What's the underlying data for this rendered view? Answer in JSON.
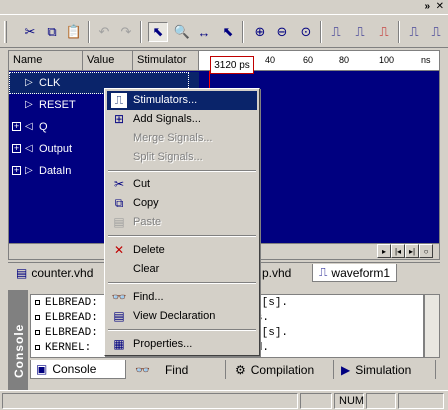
{
  "toolbar": {
    "icons": [
      "scissors-icon",
      "copy-icon",
      "paste-icon",
      "undo-icon",
      "redo-icon",
      "pointer-icon",
      "zoom-tool-icon",
      "pan-icon",
      "select-icon",
      "zoom-in-icon",
      "zoom-out-icon",
      "zoom-fit-icon",
      "waveform-icon",
      "waveform2-icon",
      "waveform3-icon",
      "waveform4-icon",
      "waveform5-icon"
    ]
  },
  "waveform": {
    "columns": {
      "name": "Name",
      "value": "Value",
      "stimulator": "Stimulator"
    },
    "time_cursor": "3120 ps",
    "ruler_ticks": [
      "40",
      "60",
      "80",
      "100",
      "ns"
    ],
    "signals": [
      {
        "name": "CLK",
        "type": "in"
      },
      {
        "name": "RESET",
        "type": "in"
      },
      {
        "name": "Q",
        "type": "out"
      },
      {
        "name": "Output",
        "type": "out"
      },
      {
        "name": "DataIn",
        "type": "in"
      }
    ]
  },
  "tabs": [
    {
      "label": "counter.vhd"
    },
    {
      "label": "p.vhd"
    },
    {
      "label": "waveform1"
    }
  ],
  "context_menu": {
    "items": [
      {
        "label": "Stimulators...",
        "icon": "stimulator-icon",
        "highlighted": true,
        "disabled": false
      },
      {
        "label": "Add Signals...",
        "icon": "add-signals-icon",
        "highlighted": false,
        "disabled": false
      },
      {
        "label": "Merge Signals...",
        "icon": "",
        "highlighted": false,
        "disabled": true
      },
      {
        "label": "Split Signals...",
        "icon": "",
        "highlighted": false,
        "disabled": true
      },
      {
        "label": "Cut",
        "icon": "scissors-icon",
        "highlighted": false,
        "disabled": false
      },
      {
        "label": "Copy",
        "icon": "copy-icon",
        "highlighted": false,
        "disabled": false
      },
      {
        "label": "Paste",
        "icon": "paste-icon",
        "highlighted": false,
        "disabled": true
      },
      {
        "label": "Delete",
        "icon": "delete-icon",
        "highlighted": false,
        "disabled": false
      },
      {
        "label": "Clear",
        "icon": "",
        "highlighted": false,
        "disabled": false
      },
      {
        "label": "Find...",
        "icon": "binoculars-icon",
        "highlighted": false,
        "disabled": false
      },
      {
        "label": "View Declaration",
        "icon": "view-declaration-icon",
        "highlighted": false,
        "disabled": false
      },
      {
        "label": "Properties...",
        "icon": "properties-icon",
        "highlighted": false,
        "disabled": false
      }
    ]
  },
  "console": {
    "label": "Console",
    "lines": [
      {
        "prefix": "ELBREAD:",
        "suffix": ".8 [s]."
      },
      {
        "prefix": "ELBREAD:",
        "suffix": "s."
      },
      {
        "prefix": "ELBREAD:",
        "suffix": ".4 [s]."
      },
      {
        "prefix": "KERNEL:",
        "suffix": "ed."
      }
    ],
    "tabs": [
      {
        "label": "Console",
        "icon": "console-icon"
      },
      {
        "label": "Find",
        "icon": "binoculars-icon"
      },
      {
        "label": "Compilation",
        "icon": "compilation-icon"
      },
      {
        "label": "Simulation",
        "icon": "simulation-icon"
      }
    ]
  },
  "statusbar": {
    "num": "NUM"
  }
}
